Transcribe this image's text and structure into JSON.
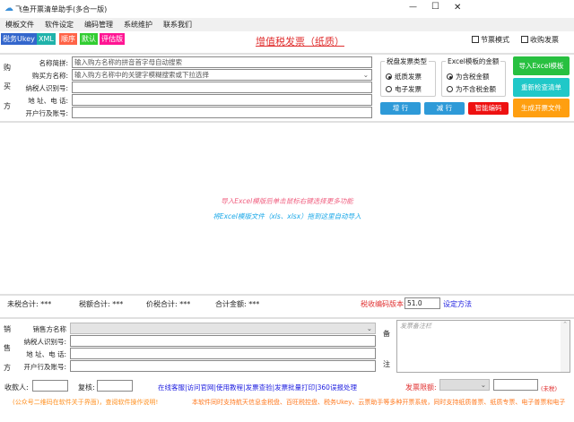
{
  "window": {
    "title": "飞鱼开票清单助手(多合一版)",
    "minimize": "—",
    "maximize": "☐",
    "close": "✕"
  },
  "menu": [
    "模板文件",
    "软件设定",
    "编码管理",
    "系统维护",
    "联系我们"
  ],
  "tags": [
    {
      "label": "税务Ukey",
      "color": "#3366cc"
    },
    {
      "label": "XML",
      "color": "#20b2aa"
    },
    {
      "label": "顺序",
      "color": "#ff6347"
    },
    {
      "label": "默认",
      "color": "#32cd32"
    },
    {
      "label": "评估版",
      "color": "#ff1493"
    }
  ],
  "invoice_title": "增值税发票（纸质）",
  "options": {
    "section_mode": "节票模式",
    "purchase_invoice": "收购发票"
  },
  "buyer": {
    "side": [
      "购",
      "买",
      "方"
    ],
    "labels": [
      "名称简拼:",
      "购买方名称:",
      "纳税人识别号:",
      "地 址、电 话:",
      "开户行及账号:"
    ],
    "placeholders": [
      "输入购方名称的拼音首字母自动搜索",
      "输入购方名称中的关键字模糊搜索或下拉选择"
    ]
  },
  "tax_disk_type": {
    "title": "税盘发票类型",
    "options": [
      "纸质发票",
      "电子发票"
    ],
    "selected": 0
  },
  "excel_amount": {
    "title": "Excel模板的金额",
    "options": [
      "为含税金额",
      "为不含税金额"
    ],
    "selected": 0
  },
  "buttons": {
    "add_row": "增 行",
    "del_row": "减 行",
    "smart_code": "智能编码",
    "import_excel": "导入Excel模板",
    "recheck": "重新检查清单",
    "generate": "生成开票文件"
  },
  "hints": [
    "导入Excel模版后单击鼠标右键选择更多功能",
    "将Excel模版文件（xls、xlsx）拖到这里自动导入"
  ],
  "totals": [
    {
      "label": "未税合计:",
      "value": "***"
    },
    {
      "label": "税额合计:",
      "value": "***"
    },
    {
      "label": "价税合计:",
      "value": "***"
    },
    {
      "label": "合计金额:",
      "value": "***"
    }
  ],
  "tax_code_version": {
    "label": "税收编码版本号:",
    "value": "51.0",
    "link": "设定方法"
  },
  "seller": {
    "side": [
      "销",
      "售",
      "方"
    ],
    "labels": [
      "销售方名称",
      "纳税人识别号:",
      "地 址、电 话:",
      "开户行及账号:"
    ]
  },
  "remarks": {
    "side": [
      "备",
      "注"
    ],
    "placeholder": "发票备注栏"
  },
  "payee": {
    "label": "收款人:",
    "value": ""
  },
  "reviewer": {
    "label": "复核:",
    "value": ""
  },
  "links": "在线客服|访问官网|使用教程|发票查验|发票批量打印|360误报处理",
  "limit": {
    "label": "发票限额:",
    "unit": "(未税)"
  },
  "footer": {
    "left": "(公众号二维码在软件关于界面)，查阅软件操作说明!",
    "right": "本软件同时支持航天信息金税盘、百旺税控盘、税务Ukey、云票助手等多种开票系统，同时支持纸质普票、纸质专票、电子普票和电子"
  }
}
